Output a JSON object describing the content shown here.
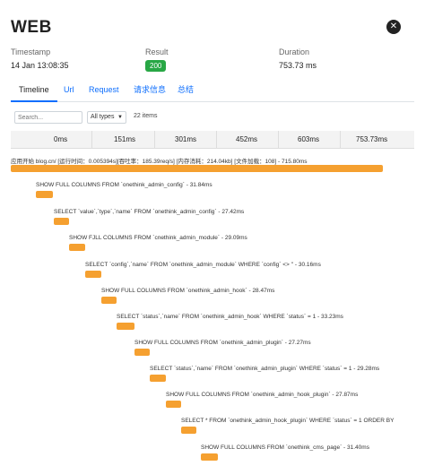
{
  "header": {
    "title": "WEB",
    "close_icon": "close-icon"
  },
  "meta": {
    "timestamp_label": "Timestamp",
    "timestamp_value": "14 Jan 13:08:35",
    "result_label": "Result",
    "result_value": "200",
    "duration_label": "Duration",
    "duration_value": "753.73 ms"
  },
  "tabs": [
    "Timeline",
    "Url",
    "Request",
    "请求信息",
    "总结"
  ],
  "toolbar": {
    "search_placeholder": "Search...",
    "type_select": "All types",
    "item_count": "22 items"
  },
  "scale": [
    "0ms",
    "151ms",
    "301ms",
    "452ms",
    "603ms",
    "753.73ms"
  ],
  "colors": {
    "bar": "#f5a030",
    "badge": "#28a745",
    "active_tab": "#0d6efd"
  },
  "rows": [
    {
      "label": "应用开始 blog.cn/ [运行时间：0.005394s][吞吐率：185.39req/s] [内存消耗：214.04kb] [文件加载：108] - 715.80ms"
    },
    {
      "label": "SHOW FULL COLUMNS FROM `onethink_admin_config` - 31.84ms"
    },
    {
      "label": "SELECT `value`,`type`,`name` FROM `onethink_admin_config` - 27.42ms"
    },
    {
      "label": "SHOW FJLL COLUMNS FROM `cnethink_admin_module` - 29.09ms"
    },
    {
      "label": "SELECT `config`,`name` FROM `onethink_admin_module` WHERE `config` <> '' - 30.16ms"
    },
    {
      "label": "SHOW FULL COLUMNS FROM `onethink_admin_hook` - 28.47ms"
    },
    {
      "label": "SELECT `status`,`name` FROM `onethink_admin_hook` WHERE `status` = 1 - 33.23ms"
    },
    {
      "label": "SHOW FULL COLUMNS FROM `onethink_admin_plugin` - 27.27ms"
    },
    {
      "label": "SELECT `status`,`name` FROM `onethink_admin_plugin` WHERE `status` = 1 - 29.28ms"
    },
    {
      "label": "SHOW FULL COLUMNS FROM `onethink_admin_hook_plugin` - 27.87ms"
    },
    {
      "label": "SELECT * FROM `onethink_admin_hook_plugin` WHERE `status` = 1 ORDER BY"
    },
    {
      "label": "SHOW FULL COLUMNS FROM `onethink_cms_page` - 31.40ms"
    }
  ]
}
